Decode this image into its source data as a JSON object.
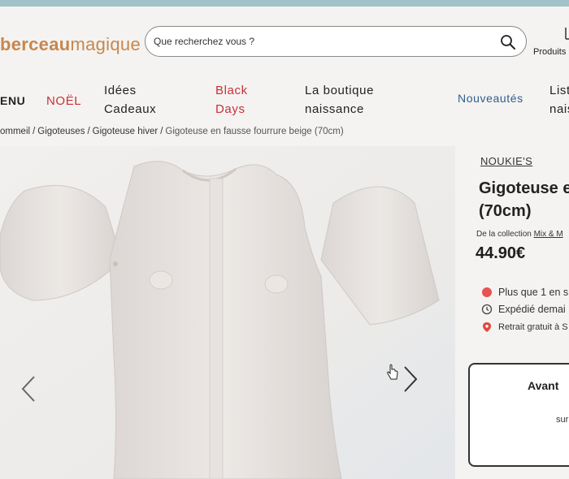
{
  "header": {
    "logo_part1": "berceau",
    "logo_part2": "magique",
    "search_placeholder": "Que recherchez vous ?",
    "account_label": "Produits"
  },
  "nav": {
    "menu": "ENU",
    "noel": "NOËL",
    "idees_line1": "Idées",
    "idees_line2": "Cadeaux",
    "black_line1": "Black",
    "black_line2": "Days",
    "boutique_line1": "La boutique",
    "boutique_line2": "naissance",
    "nouveautes": "Nouveautés",
    "listes_line1": "List",
    "listes_line2": "nais"
  },
  "breadcrumb": {
    "items": [
      "ommeil",
      "Gigoteuses",
      "Gigoteuse hiver"
    ],
    "current": "Gigoteuse en fausse fourrure beige (70cm)",
    "separator": "/"
  },
  "product": {
    "brand": "NOUKIE'S",
    "title_line1": "Gigoteuse e",
    "title_line2": "(70cm)",
    "collection_prefix": "De la collection",
    "collection_link": "Mix & M",
    "price": "44.90€",
    "stock": "Plus que 1 en s",
    "shipping": "Expédié demai",
    "pickup": "Retrait gratuit à S",
    "cta_title": "Avant",
    "cta_sub": "sur"
  },
  "colors": {
    "brand_orange": "#c8864e",
    "promo_red": "#c9303a",
    "nav_blue": "#2f5d8f",
    "stock_dot": "#e55353",
    "pin_red": "#e2473a"
  }
}
